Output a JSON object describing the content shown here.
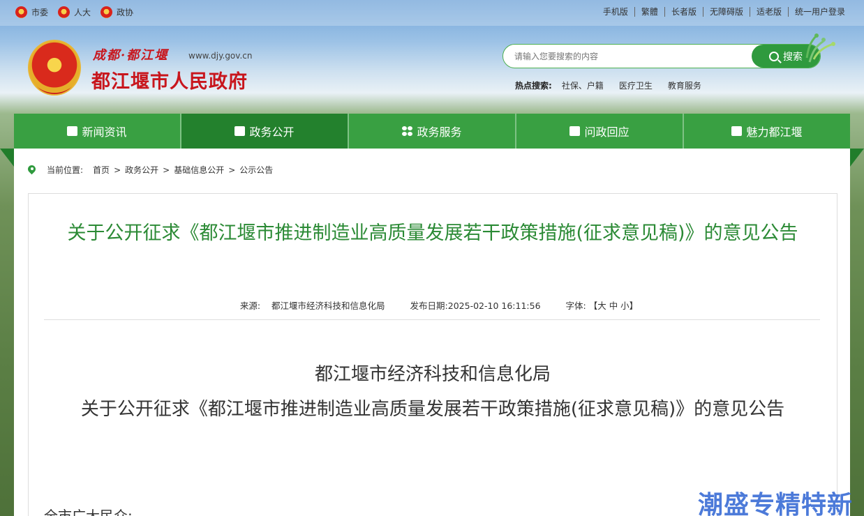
{
  "topbar": {
    "links_left": [
      "市委",
      "人大",
      "政协"
    ],
    "links_right": [
      "手机版",
      "繁體",
      "长者版",
      "无障碍版",
      "适老版",
      "统一用户登录"
    ]
  },
  "header": {
    "brand_sub": "成都·都江堰",
    "brand_url": "www.djy.gov.cn",
    "brand_main": "都江堰市人民政府",
    "search_placeholder": "请输入您要搜索的内容",
    "search_button": "搜索",
    "hot_label": "热点搜索:",
    "hot_items": [
      "社保、户籍",
      "医疗卫生",
      "教育服务"
    ]
  },
  "nav": {
    "tabs": [
      "新闻资讯",
      "政务公开",
      "政务服务",
      "问政回应",
      "魅力都江堰"
    ],
    "active_index": 1
  },
  "breadcrumb": {
    "label": "当前位置:",
    "items": [
      "首页",
      "政务公开",
      "基础信息公开",
      "公示公告"
    ],
    "separator": ">"
  },
  "article": {
    "title": "关于公开征求《都江堰市推进制造业高质量发展若干政策措施(征求意见稿)》的意见公告",
    "source_label": "来源:",
    "source": "都江堰市经济科技和信息化局",
    "date_label": "发布日期:",
    "date": "2025-02-10 16:11:56",
    "font_label": "字体:",
    "font_options": "【大 中 小】",
    "body_line1": "都江堰市经济科技和信息化局",
    "body_line2": "关于公开征求《都江堰市推进制造业高质量发展若干政策措施(征求意见稿)》的意见公告",
    "greeting": "全市广大民众:"
  },
  "watermark": "潮盛专精特新",
  "colors": {
    "accent_green": "#39a042",
    "active_green": "#23812d",
    "brand_red": "#c8161d",
    "title_green": "#2b8a35"
  }
}
